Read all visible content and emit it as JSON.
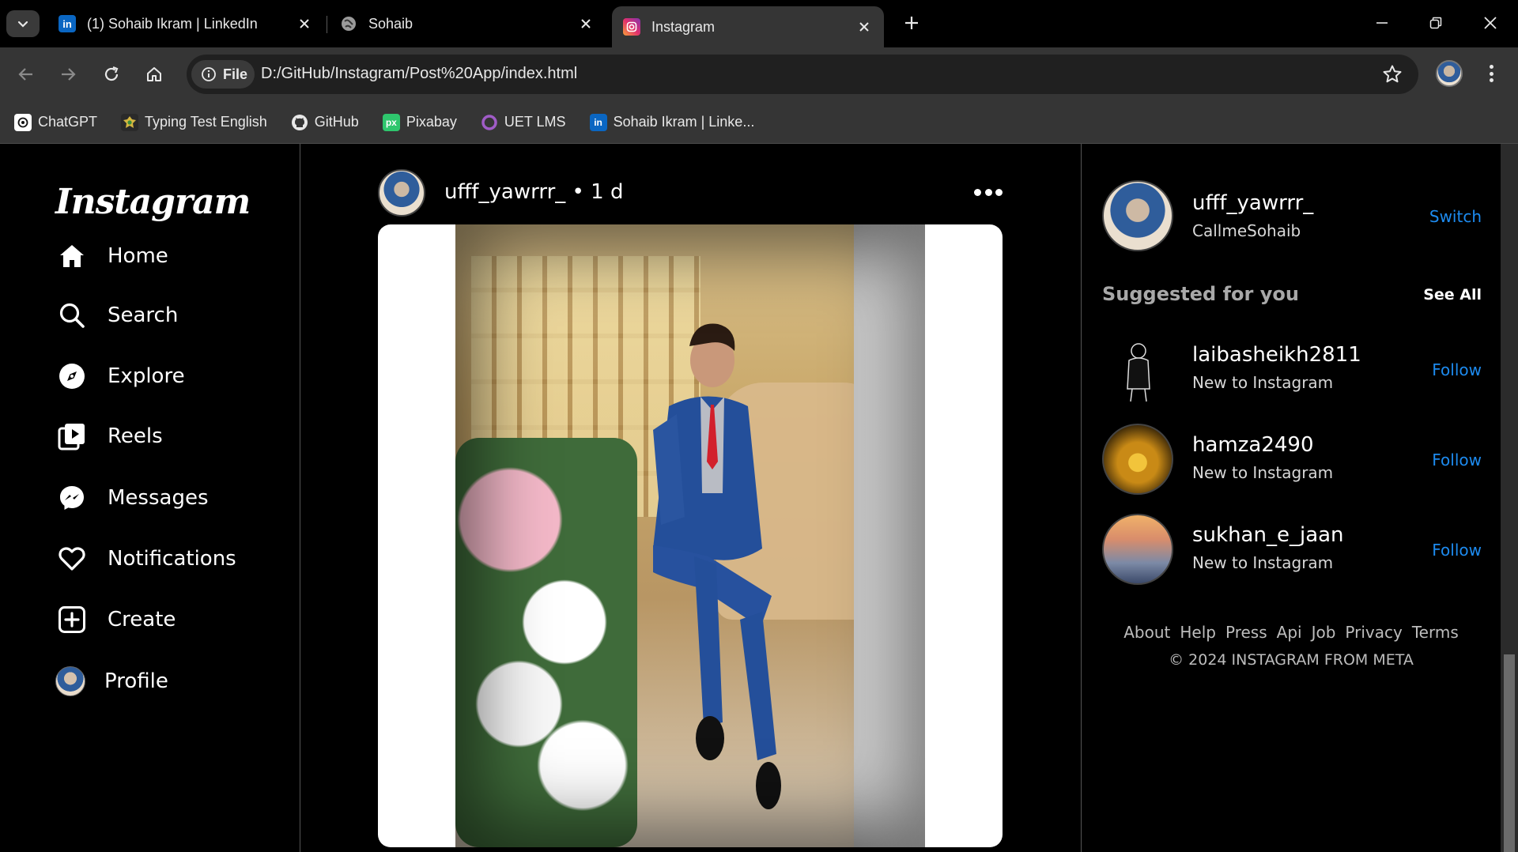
{
  "browser": {
    "tabs": [
      {
        "title": "(1) Sohaib Ikram | LinkedIn",
        "icon": "linkedin-icon",
        "active": false
      },
      {
        "title": "Sohaib",
        "icon": "globe-icon",
        "active": false
      },
      {
        "title": "Instagram",
        "icon": "instagram-icon",
        "active": true
      }
    ],
    "site_chip": "File",
    "url": "D:/GitHub/Instagram/Post%20App/index.html",
    "bookmarks": [
      {
        "label": "ChatGPT",
        "icon": "chatgpt-icon"
      },
      {
        "label": "Typing Test English",
        "icon": "typing-test-icon"
      },
      {
        "label": "GitHub",
        "icon": "github-icon"
      },
      {
        "label": "Pixabay",
        "icon": "pixabay-icon"
      },
      {
        "label": "UET LMS",
        "icon": "uet-lms-icon"
      },
      {
        "label": "Sohaib Ikram | Linke...",
        "icon": "linkedin-icon"
      }
    ]
  },
  "sidebar": {
    "logo": "Instagram",
    "items": [
      {
        "label": "Home",
        "icon": "home-icon"
      },
      {
        "label": "Search",
        "icon": "search-icon"
      },
      {
        "label": "Explore",
        "icon": "explore-icon"
      },
      {
        "label": "Reels",
        "icon": "reels-icon"
      },
      {
        "label": "Messages",
        "icon": "messenger-icon"
      },
      {
        "label": "Notifications",
        "icon": "heart-icon"
      },
      {
        "label": "Create",
        "icon": "create-icon"
      },
      {
        "label": "Profile",
        "icon": "avatar"
      }
    ]
  },
  "post": {
    "header": "ufff_yawrrr_ • 1 d"
  },
  "right_panel": {
    "me": {
      "username": "ufff_yawrrr_",
      "name": "CallmeSohaib",
      "action": "Switch"
    },
    "suggested_title": "Suggested for you",
    "see_all": "See All",
    "suggestions": [
      {
        "username": "laibasheikh2811",
        "subtitle": "New to Instagram",
        "action": "Follow"
      },
      {
        "username": "hamza2490",
        "subtitle": "New to Instagram",
        "action": "Follow"
      },
      {
        "username": "sukhan_e_jaan",
        "subtitle": "New to Instagram",
        "action": "Follow"
      }
    ],
    "footer_links": [
      "About",
      "Help",
      "Press",
      "Api",
      "Job",
      "Privacy",
      "Terms"
    ],
    "copyright": "© 2024 INSTAGRAM FROM META"
  },
  "colors": {
    "accent_link": "#1d8bf0",
    "chrome_bg": "#353535",
    "page_bg": "#000000"
  }
}
